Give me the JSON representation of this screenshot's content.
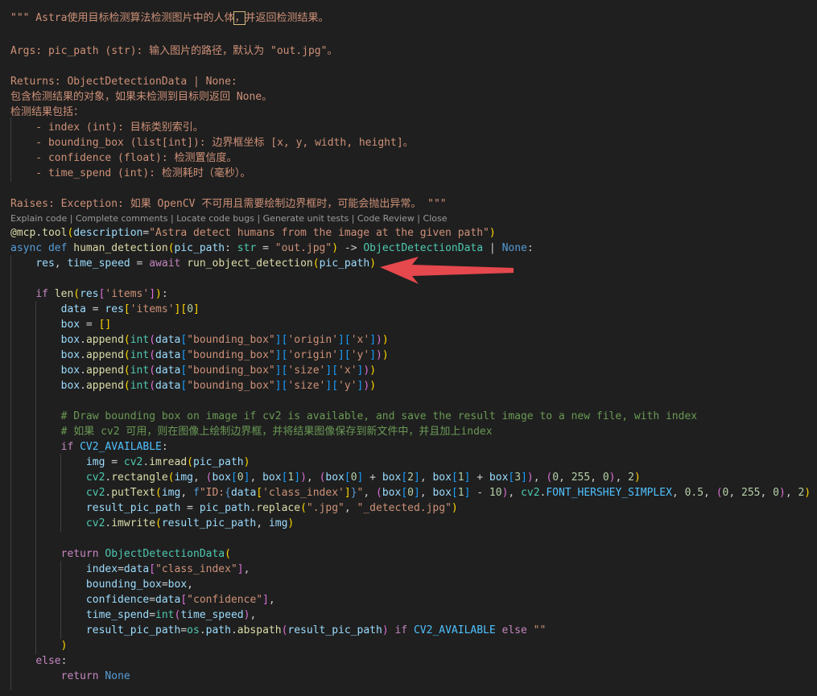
{
  "codelens": [
    "Explain code",
    "Complete comments",
    "Locate code bugs",
    "Generate unit tests",
    "Code Review",
    "Close"
  ],
  "codelens_sep": " | ",
  "code_lines": [
    [
      [
        "doc",
        "\"\"\" Astra使用目标检测算法检测图片中的人体"
      ],
      [
        "cur",
        "，"
      ],
      [
        "doc",
        "并返回检测结果。"
      ]
    ],
    [],
    [
      [
        "doc",
        "Args: pic_path (str): 输入图片的路径，默认为 \"out.jpg\"。"
      ]
    ],
    [],
    [
      [
        "doc",
        "Returns: ObjectDetectionData | None:"
      ]
    ],
    [
      [
        "doc",
        "包含检测结果的对象，如果未检测到目标则返回 None。"
      ]
    ],
    [
      [
        "doc",
        "检测结果包括："
      ]
    ],
    [
      [
        "doc",
        "    - index (int): 目标类别索引。"
      ]
    ],
    [
      [
        "doc",
        "    - bounding_box (list[int]): 边界框坐标 [x, y, width, height]。"
      ]
    ],
    [
      [
        "doc",
        "    - confidence (float): 检测置信度。"
      ]
    ],
    [
      [
        "doc",
        "    - time_spend (int): 检测耗时（毫秒）。"
      ]
    ],
    [],
    [
      [
        "doc",
        "Raises: Exception: 如果 OpenCV 不可用且需要绘制边界框时，可能会抛出异常。 \"\"\""
      ]
    ],
    [
      [
        "fn",
        "@mcp"
      ],
      [
        "pl",
        "."
      ],
      [
        "fn",
        "tool"
      ],
      [
        "b1",
        "("
      ],
      [
        "var",
        "description"
      ],
      [
        "pl",
        "="
      ],
      [
        "str",
        "\"Astra detect humans from the image at the given path\""
      ],
      [
        "b1",
        ")"
      ]
    ],
    [
      [
        "kw",
        "async"
      ],
      [
        "pl",
        " "
      ],
      [
        "kw",
        "def"
      ],
      [
        "pl",
        " "
      ],
      [
        "fn",
        "human_detection"
      ],
      [
        "b1",
        "("
      ],
      [
        "var",
        "pic_path"
      ],
      [
        "pl",
        ": "
      ],
      [
        "cls",
        "str"
      ],
      [
        "pl",
        " = "
      ],
      [
        "str",
        "\"out.jpg\""
      ],
      [
        "b1",
        ")"
      ],
      [
        "pl",
        " -> "
      ],
      [
        "cls",
        "ObjectDetectionData"
      ],
      [
        "pl",
        " | "
      ],
      [
        "kw",
        "None"
      ],
      [
        "pl",
        ":"
      ]
    ],
    [
      [
        "pl",
        "    "
      ],
      [
        "var",
        "res"
      ],
      [
        "pl",
        ", "
      ],
      [
        "var",
        "time_speed"
      ],
      [
        "pl",
        " = "
      ],
      [
        "ctl",
        "await"
      ],
      [
        "pl",
        " "
      ],
      [
        "fn",
        "run_object_detection"
      ],
      [
        "b1",
        "("
      ],
      [
        "var",
        "pic_path"
      ],
      [
        "b1",
        ")"
      ]
    ],
    [],
    [
      [
        "pl",
        "    "
      ],
      [
        "ctl",
        "if"
      ],
      [
        "pl",
        " "
      ],
      [
        "fn",
        "len"
      ],
      [
        "b1",
        "("
      ],
      [
        "var",
        "res"
      ],
      [
        "b2",
        "["
      ],
      [
        "str",
        "'items'"
      ],
      [
        "b2",
        "]"
      ],
      [
        "b1",
        ")"
      ],
      [
        "pl",
        ":"
      ]
    ],
    [
      [
        "pl",
        "        "
      ],
      [
        "var",
        "data"
      ],
      [
        "pl",
        " = "
      ],
      [
        "var",
        "res"
      ],
      [
        "b1",
        "["
      ],
      [
        "str",
        "'items'"
      ],
      [
        "b1",
        "]"
      ],
      [
        "b1",
        "["
      ],
      [
        "num",
        "0"
      ],
      [
        "b1",
        "]"
      ]
    ],
    [
      [
        "pl",
        "        "
      ],
      [
        "var",
        "box"
      ],
      [
        "pl",
        " = "
      ],
      [
        "b1",
        "[]"
      ]
    ],
    [
      [
        "pl",
        "        "
      ],
      [
        "var",
        "box"
      ],
      [
        "pl",
        "."
      ],
      [
        "fn",
        "append"
      ],
      [
        "b1",
        "("
      ],
      [
        "cls",
        "int"
      ],
      [
        "b2",
        "("
      ],
      [
        "var",
        "data"
      ],
      [
        "b3",
        "["
      ],
      [
        "str",
        "\"bounding_box\""
      ],
      [
        "b3",
        "]"
      ],
      [
        "b3",
        "["
      ],
      [
        "str",
        "'origin'"
      ],
      [
        "b3",
        "]"
      ],
      [
        "b3",
        "["
      ],
      [
        "str",
        "'x'"
      ],
      [
        "b3",
        "]"
      ],
      [
        "b2",
        ")"
      ],
      [
        "b1",
        ")"
      ]
    ],
    [
      [
        "pl",
        "        "
      ],
      [
        "var",
        "box"
      ],
      [
        "pl",
        "."
      ],
      [
        "fn",
        "append"
      ],
      [
        "b1",
        "("
      ],
      [
        "cls",
        "int"
      ],
      [
        "b2",
        "("
      ],
      [
        "var",
        "data"
      ],
      [
        "b3",
        "["
      ],
      [
        "str",
        "\"bounding_box\""
      ],
      [
        "b3",
        "]"
      ],
      [
        "b3",
        "["
      ],
      [
        "str",
        "'origin'"
      ],
      [
        "b3",
        "]"
      ],
      [
        "b3",
        "["
      ],
      [
        "str",
        "'y'"
      ],
      [
        "b3",
        "]"
      ],
      [
        "b2",
        ")"
      ],
      [
        "b1",
        ")"
      ]
    ],
    [
      [
        "pl",
        "        "
      ],
      [
        "var",
        "box"
      ],
      [
        "pl",
        "."
      ],
      [
        "fn",
        "append"
      ],
      [
        "b1",
        "("
      ],
      [
        "cls",
        "int"
      ],
      [
        "b2",
        "("
      ],
      [
        "var",
        "data"
      ],
      [
        "b3",
        "["
      ],
      [
        "str",
        "\"bounding_box\""
      ],
      [
        "b3",
        "]"
      ],
      [
        "b3",
        "["
      ],
      [
        "str",
        "'size'"
      ],
      [
        "b3",
        "]"
      ],
      [
        "b3",
        "["
      ],
      [
        "str",
        "'x'"
      ],
      [
        "b3",
        "]"
      ],
      [
        "b2",
        ")"
      ],
      [
        "b1",
        ")"
      ]
    ],
    [
      [
        "pl",
        "        "
      ],
      [
        "var",
        "box"
      ],
      [
        "pl",
        "."
      ],
      [
        "fn",
        "append"
      ],
      [
        "b1",
        "("
      ],
      [
        "cls",
        "int"
      ],
      [
        "b2",
        "("
      ],
      [
        "var",
        "data"
      ],
      [
        "b3",
        "["
      ],
      [
        "str",
        "\"bounding_box\""
      ],
      [
        "b3",
        "]"
      ],
      [
        "b3",
        "["
      ],
      [
        "str",
        "'size'"
      ],
      [
        "b3",
        "]"
      ],
      [
        "b3",
        "["
      ],
      [
        "str",
        "'y'"
      ],
      [
        "b3",
        "]"
      ],
      [
        "b2",
        ")"
      ],
      [
        "b1",
        ")"
      ]
    ],
    [],
    [
      [
        "pl",
        "        "
      ],
      [
        "cm",
        "# Draw bounding box on image if cv2 is available, and save the result image to a new file, with index"
      ]
    ],
    [
      [
        "pl",
        "        "
      ],
      [
        "cm",
        "# 如果 cv2 可用，则在图像上绘制边界框，并将结果图像保存到新文件中，并且加上index"
      ]
    ],
    [
      [
        "pl",
        "        "
      ],
      [
        "ctl",
        "if"
      ],
      [
        "pl",
        " "
      ],
      [
        "cst",
        "CV2_AVAILABLE"
      ],
      [
        "pl",
        ":"
      ]
    ],
    [
      [
        "pl",
        "            "
      ],
      [
        "var",
        "img"
      ],
      [
        "pl",
        " = "
      ],
      [
        "cls",
        "cv2"
      ],
      [
        "pl",
        "."
      ],
      [
        "fn",
        "imread"
      ],
      [
        "b1",
        "("
      ],
      [
        "var",
        "pic_path"
      ],
      [
        "b1",
        ")"
      ]
    ],
    [
      [
        "pl",
        "            "
      ],
      [
        "cls",
        "cv2"
      ],
      [
        "pl",
        "."
      ],
      [
        "fn",
        "rectangle"
      ],
      [
        "b1",
        "("
      ],
      [
        "var",
        "img"
      ],
      [
        "pl",
        ", "
      ],
      [
        "b2",
        "("
      ],
      [
        "var",
        "box"
      ],
      [
        "b3",
        "["
      ],
      [
        "num",
        "0"
      ],
      [
        "b3",
        "]"
      ],
      [
        "pl",
        ", "
      ],
      [
        "var",
        "box"
      ],
      [
        "b3",
        "["
      ],
      [
        "num",
        "1"
      ],
      [
        "b3",
        "]"
      ],
      [
        "b2",
        ")"
      ],
      [
        "pl",
        ", "
      ],
      [
        "b2",
        "("
      ],
      [
        "var",
        "box"
      ],
      [
        "b3",
        "["
      ],
      [
        "num",
        "0"
      ],
      [
        "b3",
        "]"
      ],
      [
        "pl",
        " + "
      ],
      [
        "var",
        "box"
      ],
      [
        "b3",
        "["
      ],
      [
        "num",
        "2"
      ],
      [
        "b3",
        "]"
      ],
      [
        "pl",
        ", "
      ],
      [
        "var",
        "box"
      ],
      [
        "b3",
        "["
      ],
      [
        "num",
        "1"
      ],
      [
        "b3",
        "]"
      ],
      [
        "pl",
        " + "
      ],
      [
        "var",
        "box"
      ],
      [
        "b3",
        "["
      ],
      [
        "num",
        "3"
      ],
      [
        "b3",
        "]"
      ],
      [
        "b2",
        ")"
      ],
      [
        "pl",
        ", "
      ],
      [
        "b2",
        "("
      ],
      [
        "num",
        "0"
      ],
      [
        "pl",
        ", "
      ],
      [
        "num",
        "255"
      ],
      [
        "pl",
        ", "
      ],
      [
        "num",
        "0"
      ],
      [
        "b2",
        ")"
      ],
      [
        "pl",
        ", "
      ],
      [
        "num",
        "2"
      ],
      [
        "b1",
        ")"
      ]
    ],
    [
      [
        "pl",
        "            "
      ],
      [
        "cls",
        "cv2"
      ],
      [
        "pl",
        "."
      ],
      [
        "fn",
        "putText"
      ],
      [
        "b1",
        "("
      ],
      [
        "var",
        "img"
      ],
      [
        "pl",
        ", "
      ],
      [
        "kw",
        "f"
      ],
      [
        "str",
        "\"ID:"
      ],
      [
        "kw",
        "{"
      ],
      [
        "var",
        "data"
      ],
      [
        "b1",
        "["
      ],
      [
        "str",
        "'class_index'"
      ],
      [
        "b1",
        "]"
      ],
      [
        "kw",
        "}"
      ],
      [
        "str",
        "\""
      ],
      [
        "pl",
        ", "
      ],
      [
        "b2",
        "("
      ],
      [
        "var",
        "box"
      ],
      [
        "b3",
        "["
      ],
      [
        "num",
        "0"
      ],
      [
        "b3",
        "]"
      ],
      [
        "pl",
        ", "
      ],
      [
        "var",
        "box"
      ],
      [
        "b3",
        "["
      ],
      [
        "num",
        "1"
      ],
      [
        "b3",
        "]"
      ],
      [
        "pl",
        " - "
      ],
      [
        "num",
        "10"
      ],
      [
        "b2",
        ")"
      ],
      [
        "pl",
        ", "
      ],
      [
        "cls",
        "cv2"
      ],
      [
        "pl",
        "."
      ],
      [
        "cst",
        "FONT_HERSHEY_SIMPLEX"
      ],
      [
        "pl",
        ", "
      ],
      [
        "num",
        "0.5"
      ],
      [
        "pl",
        ", "
      ],
      [
        "b2",
        "("
      ],
      [
        "num",
        "0"
      ],
      [
        "pl",
        ", "
      ],
      [
        "num",
        "255"
      ],
      [
        "pl",
        ", "
      ],
      [
        "num",
        "0"
      ],
      [
        "b2",
        ")"
      ],
      [
        "pl",
        ", "
      ],
      [
        "num",
        "2"
      ],
      [
        "b1",
        ")"
      ]
    ],
    [
      [
        "pl",
        "            "
      ],
      [
        "var",
        "result_pic_path"
      ],
      [
        "pl",
        " = "
      ],
      [
        "var",
        "pic_path"
      ],
      [
        "pl",
        "."
      ],
      [
        "fn",
        "replace"
      ],
      [
        "b1",
        "("
      ],
      [
        "str",
        "\".jpg\""
      ],
      [
        "pl",
        ", "
      ],
      [
        "str",
        "\"_detected.jpg\""
      ],
      [
        "b1",
        ")"
      ]
    ],
    [
      [
        "pl",
        "            "
      ],
      [
        "cls",
        "cv2"
      ],
      [
        "pl",
        "."
      ],
      [
        "fn",
        "imwrite"
      ],
      [
        "b1",
        "("
      ],
      [
        "var",
        "result_pic_path"
      ],
      [
        "pl",
        ", "
      ],
      [
        "var",
        "img"
      ],
      [
        "b1",
        ")"
      ]
    ],
    [],
    [
      [
        "pl",
        "        "
      ],
      [
        "ctl",
        "return"
      ],
      [
        "pl",
        " "
      ],
      [
        "cls",
        "ObjectDetectionData"
      ],
      [
        "b1",
        "("
      ]
    ],
    [
      [
        "pl",
        "            "
      ],
      [
        "var",
        "index"
      ],
      [
        "pl",
        "="
      ],
      [
        "var",
        "data"
      ],
      [
        "b2",
        "["
      ],
      [
        "str",
        "\"class_index\""
      ],
      [
        "b2",
        "]"
      ],
      [
        "pl",
        ","
      ]
    ],
    [
      [
        "pl",
        "            "
      ],
      [
        "var",
        "bounding_box"
      ],
      [
        "pl",
        "="
      ],
      [
        "var",
        "box"
      ],
      [
        "pl",
        ","
      ]
    ],
    [
      [
        "pl",
        "            "
      ],
      [
        "var",
        "confidence"
      ],
      [
        "pl",
        "="
      ],
      [
        "var",
        "data"
      ],
      [
        "b2",
        "["
      ],
      [
        "str",
        "\"confidence\""
      ],
      [
        "b2",
        "]"
      ],
      [
        "pl",
        ","
      ]
    ],
    [
      [
        "pl",
        "            "
      ],
      [
        "var",
        "time_spend"
      ],
      [
        "pl",
        "="
      ],
      [
        "cls",
        "int"
      ],
      [
        "b2",
        "("
      ],
      [
        "var",
        "time_speed"
      ],
      [
        "b2",
        ")"
      ],
      [
        "pl",
        ","
      ]
    ],
    [
      [
        "pl",
        "            "
      ],
      [
        "var",
        "result_pic_path"
      ],
      [
        "pl",
        "="
      ],
      [
        "cls",
        "os"
      ],
      [
        "pl",
        "."
      ],
      [
        "var",
        "path"
      ],
      [
        "pl",
        "."
      ],
      [
        "fn",
        "abspath"
      ],
      [
        "b2",
        "("
      ],
      [
        "var",
        "result_pic_path"
      ],
      [
        "b2",
        ")"
      ],
      [
        "pl",
        " "
      ],
      [
        "ctl",
        "if"
      ],
      [
        "pl",
        " "
      ],
      [
        "cst",
        "CV2_AVAILABLE"
      ],
      [
        "pl",
        " "
      ],
      [
        "ctl",
        "else"
      ],
      [
        "pl",
        " "
      ],
      [
        "str",
        "\"\""
      ]
    ],
    [
      [
        "pl",
        "        "
      ],
      [
        "b1",
        ")"
      ]
    ],
    [
      [
        "pl",
        "    "
      ],
      [
        "ctl",
        "else"
      ],
      [
        "pl",
        ":"
      ]
    ],
    [
      [
        "pl",
        "        "
      ],
      [
        "ctl",
        "return"
      ],
      [
        "pl",
        " "
      ],
      [
        "kw",
        "None"
      ]
    ]
  ],
  "arrow_color": "#e5484d"
}
